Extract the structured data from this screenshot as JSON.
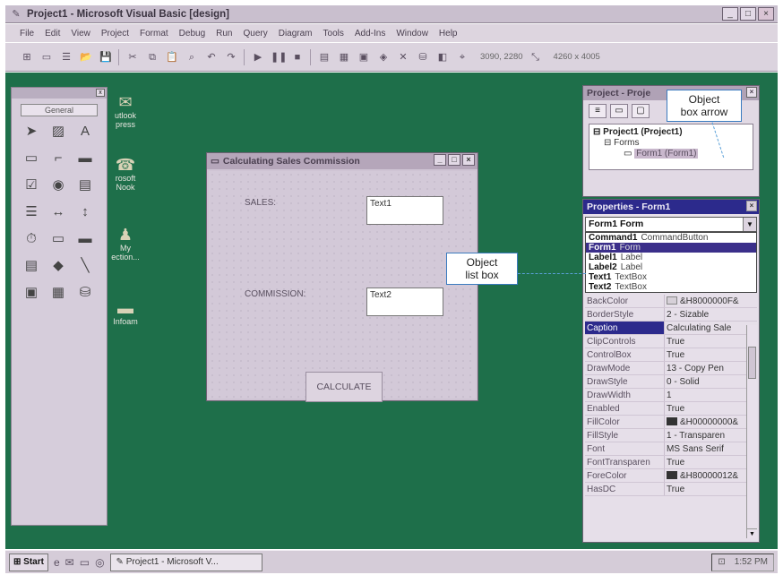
{
  "window": {
    "title": "Project1 - Microsoft Visual Basic [design]",
    "min": "_",
    "max": "□",
    "close": "×"
  },
  "menu": [
    "File",
    "Edit",
    "View",
    "Project",
    "Format",
    "Debug",
    "Run",
    "Query",
    "Diagram",
    "Tools",
    "Add-Ins",
    "Window",
    "Help"
  ],
  "toolbar": {
    "position": "3090, 2280",
    "size": "4260 x 4005"
  },
  "toolbox": {
    "general": "General",
    "close": "x"
  },
  "desktop_icons": [
    {
      "label": "utlook\npress"
    },
    {
      "label": "rosoft\nNook"
    },
    {
      "label": "My\nection..."
    },
    {
      "label": "Infoam"
    }
  ],
  "form": {
    "title": "Calculating Sales Commission",
    "sales_label": "SALES:",
    "text1": "Text1",
    "commission_label": "COMMISSION:",
    "text2": "Text2",
    "button": "CALCULATE"
  },
  "project": {
    "title": "Project - Proje",
    "tree_root": "Project1 (Project1)",
    "tree_folder": "Forms",
    "tree_item": "Form1 (Form1)"
  },
  "properties": {
    "title": "Properties - Form1",
    "object_box": "Form1 Form",
    "object_list": [
      {
        "name": "Command1",
        "type": "CommandButton"
      },
      {
        "name": "Form1",
        "type": "Form"
      },
      {
        "name": "Label1",
        "type": "Label"
      },
      {
        "name": "Label2",
        "type": "Label"
      },
      {
        "name": "Text1",
        "type": "TextBox"
      },
      {
        "name": "Text2",
        "type": "TextBox"
      }
    ],
    "rows": [
      {
        "name": "BackColor",
        "value": "&H8000000F&"
      },
      {
        "name": "BorderStyle",
        "value": "2 - Sizable"
      },
      {
        "name": "Caption",
        "value": "Calculating Sale"
      },
      {
        "name": "ClipControls",
        "value": "True"
      },
      {
        "name": "ControlBox",
        "value": "True"
      },
      {
        "name": "DrawMode",
        "value": "13 - Copy Pen"
      },
      {
        "name": "DrawStyle",
        "value": "0 - Solid"
      },
      {
        "name": "DrawWidth",
        "value": "1"
      },
      {
        "name": "Enabled",
        "value": "True"
      },
      {
        "name": "FillColor",
        "value": "&H00000000&"
      },
      {
        "name": "FillStyle",
        "value": "1 - Transparen"
      },
      {
        "name": "Font",
        "value": "MS Sans Serif"
      },
      {
        "name": "FontTransparen",
        "value": "True"
      },
      {
        "name": "ForeColor",
        "value": "&H80000012&"
      },
      {
        "name": "HasDC",
        "value": "True"
      }
    ]
  },
  "callouts": {
    "object_box_arrow": "Object\nbox arrow",
    "object_list_box": "Object\nlist box"
  },
  "taskbar": {
    "start": "Start",
    "task": "Project1 - Microsoft V...",
    "clock": "1:52 PM"
  },
  "colors": {
    "desktop": "#1e6f4a",
    "titlebar": "#c9bfce",
    "selection": "#2c2a8c",
    "callout_border": "#3b7bbf"
  }
}
